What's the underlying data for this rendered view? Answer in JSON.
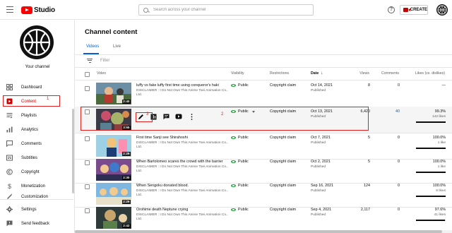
{
  "app": {
    "logo_text": "Studio",
    "brand_color": "#ff0000",
    "accent_color": "#065fd4"
  },
  "search": {
    "placeholder": "Search across your channel"
  },
  "header": {
    "create_label": "CREATE",
    "help_glyph": "?"
  },
  "sidebar": {
    "channel_label": "Your channel",
    "items": [
      {
        "label": "Dashboard",
        "icon": "dashboard-icon"
      },
      {
        "label": "Content",
        "icon": "content-icon",
        "active": true
      },
      {
        "label": "Playlists",
        "icon": "playlists-icon"
      },
      {
        "label": "Analytics",
        "icon": "analytics-icon"
      },
      {
        "label": "Comments",
        "icon": "comments-icon"
      },
      {
        "label": "Subtitles",
        "icon": "subtitles-icon"
      },
      {
        "label": "Copyright",
        "icon": "copyright-icon"
      },
      {
        "label": "Monetization",
        "icon": "monetization-icon"
      },
      {
        "label": "Customization",
        "icon": "customization-icon"
      }
    ],
    "footer": [
      {
        "label": "Settings",
        "icon": "gear-icon"
      },
      {
        "label": "Send feedback",
        "icon": "feedback-icon"
      }
    ]
  },
  "annotations": {
    "one": "1",
    "two": "2",
    "three": "3"
  },
  "main": {
    "title": "Channel content",
    "tabs": [
      "Videos",
      "Live"
    ],
    "filter_placeholder": "Filter",
    "columns": {
      "video": "Video",
      "visibility": "Visibility",
      "restrictions": "Restrictions",
      "date": "Date",
      "views": "Views",
      "comments": "Comments",
      "likes": "Likes (vs. dislikes)"
    },
    "rows": [
      {
        "title": "luffy vs fake luffy first time using conqueror's haki",
        "desc": "DISCLAIMER : I Do Not Own This Anime Toei Animation Co., Ltd.",
        "duration": "2:40",
        "visibility": "Public",
        "restrictions": "Copyright claim",
        "date": "Oct 14, 2021",
        "status": "Published",
        "views": "8",
        "comments": "0",
        "likes": "—",
        "likes_sub": "",
        "like_fraction": null
      },
      {
        "title": "",
        "desc": "",
        "duration": "3:55",
        "visibility": "Public",
        "restrictions": "Copyright claim",
        "date": "Oct 13, 2021",
        "status": "Published",
        "views": "6,420",
        "comments": "40",
        "likes": "99.3%",
        "likes_sub": "142 likes",
        "like_fraction": 0.993
      },
      {
        "title": "First time Sanji see Shirahoshi",
        "desc": "DISCLAIMER : I Do Not Own This Anime Toei Animation Co., Ltd.",
        "duration": "2:29",
        "visibility": "Public",
        "restrictions": "Copyright claim",
        "date": "Oct 7, 2021",
        "status": "Published",
        "views": "5",
        "comments": "0",
        "likes": "100.0%",
        "likes_sub": "1 like",
        "like_fraction": 1.0
      },
      {
        "title": "When Bartolomeo scares the crowd with the barrier",
        "desc": "DISCLAIMER : I Do Not Own This Anime Toei Animation Co., Ltd.",
        "duration": "2:30",
        "visibility": "Public",
        "restrictions": "Copyright claim",
        "date": "Oct 2, 2021",
        "status": "Published",
        "views": "5",
        "comments": "0",
        "likes": "100.0%",
        "likes_sub": "1 like",
        "like_fraction": 1.0
      },
      {
        "title": "When Sengoku donated blood.",
        "desc": "DISCLAIMER : I Do Not Own This Anime Toei Animation Co., Ltd.",
        "duration": "2:29",
        "visibility": "Public",
        "restrictions": "Copyright claim",
        "date": "Sep 16, 2021",
        "status": "Published",
        "views": "124",
        "comments": "0",
        "likes": "100.0%",
        "likes_sub": "6 likes",
        "like_fraction": 1.0
      },
      {
        "title": "Orohime death Neptune crying",
        "desc": "DISCLAIMER : I Do Not Own This Anime Toei Animation Co., Ltd.",
        "duration": "2:42",
        "visibility": "Public",
        "restrictions": "Copyright claim",
        "date": "Sep 4, 2021",
        "status": "Published",
        "views": "2,117",
        "comments": "0",
        "likes": "97.6%",
        "likes_sub": "41 likes",
        "like_fraction": 0.976
      }
    ]
  }
}
